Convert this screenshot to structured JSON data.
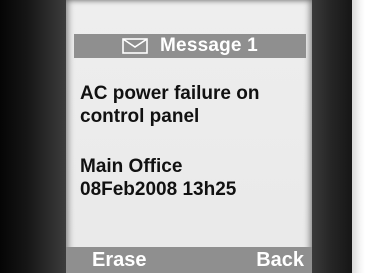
{
  "header": {
    "title": "Message 1",
    "icon": "envelope-icon"
  },
  "message": {
    "lines": [
      "AC power failure on",
      "control panel",
      "Main Office",
      "08Feb2008 13h25"
    ]
  },
  "softkeys": {
    "left": "Erase",
    "right": "Back"
  },
  "colors": {
    "bar": "#8f8f8f",
    "screen": "#eeeeee",
    "text": "#111111"
  }
}
